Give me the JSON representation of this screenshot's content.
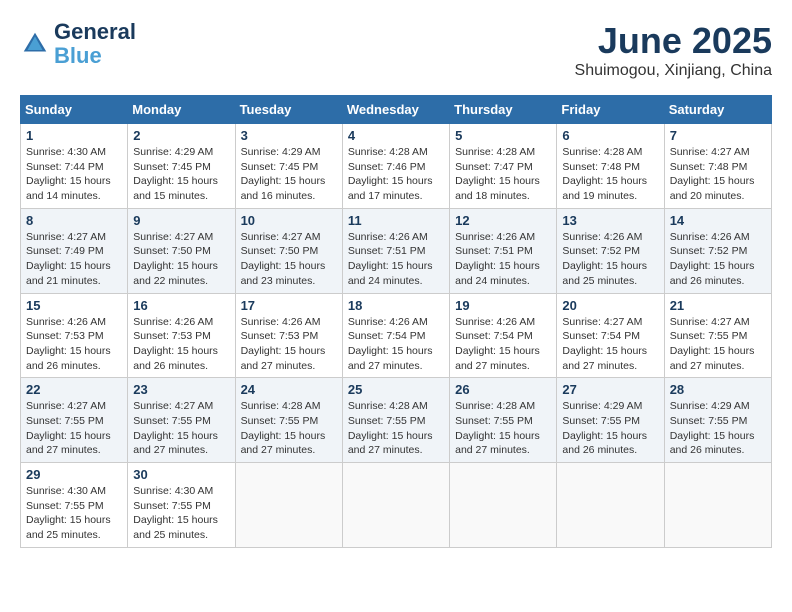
{
  "header": {
    "logo_line1": "General",
    "logo_line2": "Blue",
    "month": "June 2025",
    "location": "Shuimogou, Xinjiang, China"
  },
  "weekdays": [
    "Sunday",
    "Monday",
    "Tuesday",
    "Wednesday",
    "Thursday",
    "Friday",
    "Saturday"
  ],
  "weeks": [
    [
      {
        "day": 1,
        "sunrise": "4:30 AM",
        "sunset": "7:44 PM",
        "daylight": "15 hours and 14 minutes."
      },
      {
        "day": 2,
        "sunrise": "4:29 AM",
        "sunset": "7:45 PM",
        "daylight": "15 hours and 15 minutes."
      },
      {
        "day": 3,
        "sunrise": "4:29 AM",
        "sunset": "7:45 PM",
        "daylight": "15 hours and 16 minutes."
      },
      {
        "day": 4,
        "sunrise": "4:28 AM",
        "sunset": "7:46 PM",
        "daylight": "15 hours and 17 minutes."
      },
      {
        "day": 5,
        "sunrise": "4:28 AM",
        "sunset": "7:47 PM",
        "daylight": "15 hours and 18 minutes."
      },
      {
        "day": 6,
        "sunrise": "4:28 AM",
        "sunset": "7:48 PM",
        "daylight": "15 hours and 19 minutes."
      },
      {
        "day": 7,
        "sunrise": "4:27 AM",
        "sunset": "7:48 PM",
        "daylight": "15 hours and 20 minutes."
      }
    ],
    [
      {
        "day": 8,
        "sunrise": "4:27 AM",
        "sunset": "7:49 PM",
        "daylight": "15 hours and 21 minutes."
      },
      {
        "day": 9,
        "sunrise": "4:27 AM",
        "sunset": "7:50 PM",
        "daylight": "15 hours and 22 minutes."
      },
      {
        "day": 10,
        "sunrise": "4:27 AM",
        "sunset": "7:50 PM",
        "daylight": "15 hours and 23 minutes."
      },
      {
        "day": 11,
        "sunrise": "4:26 AM",
        "sunset": "7:51 PM",
        "daylight": "15 hours and 24 minutes."
      },
      {
        "day": 12,
        "sunrise": "4:26 AM",
        "sunset": "7:51 PM",
        "daylight": "15 hours and 24 minutes."
      },
      {
        "day": 13,
        "sunrise": "4:26 AM",
        "sunset": "7:52 PM",
        "daylight": "15 hours and 25 minutes."
      },
      {
        "day": 14,
        "sunrise": "4:26 AM",
        "sunset": "7:52 PM",
        "daylight": "15 hours and 26 minutes."
      }
    ],
    [
      {
        "day": 15,
        "sunrise": "4:26 AM",
        "sunset": "7:53 PM",
        "daylight": "15 hours and 26 minutes."
      },
      {
        "day": 16,
        "sunrise": "4:26 AM",
        "sunset": "7:53 PM",
        "daylight": "15 hours and 26 minutes."
      },
      {
        "day": 17,
        "sunrise": "4:26 AM",
        "sunset": "7:53 PM",
        "daylight": "15 hours and 27 minutes."
      },
      {
        "day": 18,
        "sunrise": "4:26 AM",
        "sunset": "7:54 PM",
        "daylight": "15 hours and 27 minutes."
      },
      {
        "day": 19,
        "sunrise": "4:26 AM",
        "sunset": "7:54 PM",
        "daylight": "15 hours and 27 minutes."
      },
      {
        "day": 20,
        "sunrise": "4:27 AM",
        "sunset": "7:54 PM",
        "daylight": "15 hours and 27 minutes."
      },
      {
        "day": 21,
        "sunrise": "4:27 AM",
        "sunset": "7:55 PM",
        "daylight": "15 hours and 27 minutes."
      }
    ],
    [
      {
        "day": 22,
        "sunrise": "4:27 AM",
        "sunset": "7:55 PM",
        "daylight": "15 hours and 27 minutes."
      },
      {
        "day": 23,
        "sunrise": "4:27 AM",
        "sunset": "7:55 PM",
        "daylight": "15 hours and 27 minutes."
      },
      {
        "day": 24,
        "sunrise": "4:28 AM",
        "sunset": "7:55 PM",
        "daylight": "15 hours and 27 minutes."
      },
      {
        "day": 25,
        "sunrise": "4:28 AM",
        "sunset": "7:55 PM",
        "daylight": "15 hours and 27 minutes."
      },
      {
        "day": 26,
        "sunrise": "4:28 AM",
        "sunset": "7:55 PM",
        "daylight": "15 hours and 27 minutes."
      },
      {
        "day": 27,
        "sunrise": "4:29 AM",
        "sunset": "7:55 PM",
        "daylight": "15 hours and 26 minutes."
      },
      {
        "day": 28,
        "sunrise": "4:29 AM",
        "sunset": "7:55 PM",
        "daylight": "15 hours and 26 minutes."
      }
    ],
    [
      {
        "day": 29,
        "sunrise": "4:30 AM",
        "sunset": "7:55 PM",
        "daylight": "15 hours and 25 minutes."
      },
      {
        "day": 30,
        "sunrise": "4:30 AM",
        "sunset": "7:55 PM",
        "daylight": "15 hours and 25 minutes."
      },
      null,
      null,
      null,
      null,
      null
    ]
  ]
}
